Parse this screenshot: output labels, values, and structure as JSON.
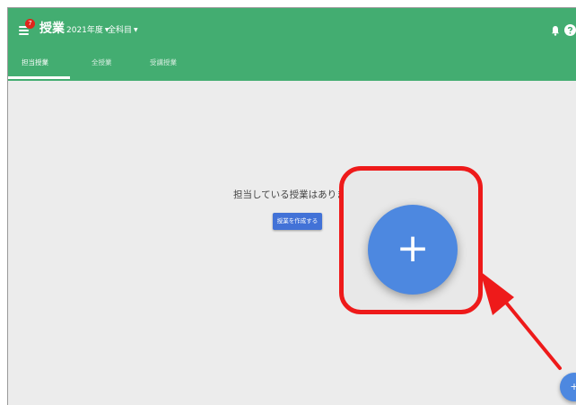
{
  "header": {
    "notification_count": "7",
    "title": "授業",
    "year_select": "2021年度",
    "subject_select": "全科目"
  },
  "tabs": [
    {
      "label": "担当授業",
      "active": true
    },
    {
      "label": "全授業",
      "active": false
    },
    {
      "label": "受講授業",
      "active": false
    }
  ],
  "main": {
    "empty_message": "担当している授業はありません",
    "create_button": "授業を作成する"
  },
  "fab": {
    "symbol": "+"
  },
  "colors": {
    "appbar": "#43ad71",
    "badge": "#e0251b",
    "primary_button": "#4272d7",
    "fab": "#4d88e0",
    "annotation": "#ee1a1a"
  },
  "icons": [
    "menu-icon",
    "bell-icon",
    "help-icon",
    "plus-icon",
    "arrow-annotation"
  ]
}
